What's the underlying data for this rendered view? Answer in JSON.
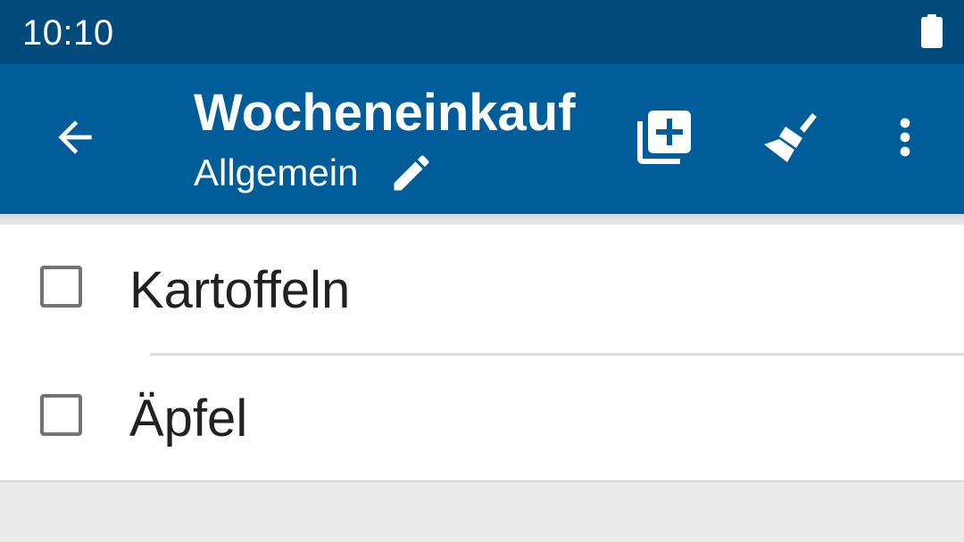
{
  "status_bar": {
    "time": "10:10",
    "battery_icon": "battery-full-icon"
  },
  "app_bar": {
    "title": "Wocheneinkauf",
    "subtitle": "Allgemein",
    "back_icon": "arrow-back-icon",
    "edit_icon": "pencil-icon",
    "actions": [
      {
        "name": "add-item",
        "icon": "library-add-icon"
      },
      {
        "name": "clear-checked",
        "icon": "broom-icon"
      },
      {
        "name": "more-options",
        "icon": "more-vert-icon"
      }
    ],
    "colors": {
      "status_bar": "#014a7c",
      "toolbar": "#015d9a",
      "on_primary": "#ffffff"
    }
  },
  "list": {
    "items": [
      {
        "label": "Kartoffeln",
        "checked": false
      },
      {
        "label": "Äpfel",
        "checked": false
      }
    ]
  }
}
